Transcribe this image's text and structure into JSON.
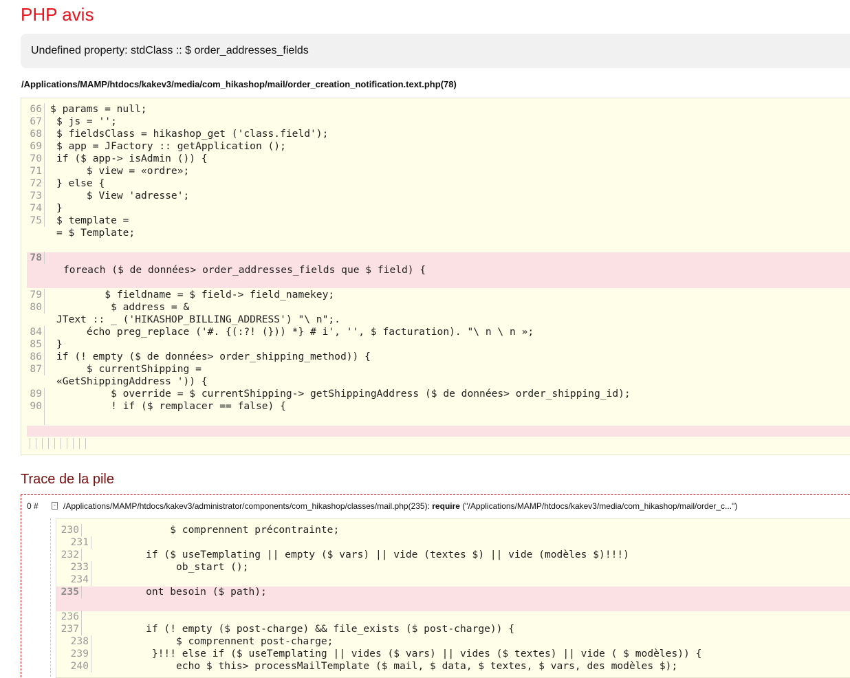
{
  "page_title": "PHP avis",
  "message": "Undefined property: stdClass :: $ order_addresses_fields",
  "file_path": "/Applications/MAMP/htdocs/kakev3/media/com_hikashop/mail/order_creation_notification.text.php(78)",
  "code_lines": [
    {
      "num": "66",
      "text": "$ params = null;"
    },
    {
      "num": "67",
      "text": "$ js = '';"
    },
    {
      "num": "68",
      "text": "$ fieldsClass = hikashop_get ('class.field');"
    },
    {
      "num": "69",
      "text": "$ app = JFactory :: getApplication ();"
    },
    {
      "num": "70",
      "text": "if ($ app-> isAdmin ()) {"
    },
    {
      "num": "71",
      "text": "     $ view = «ordre»;"
    },
    {
      "num": "72",
      "text": "} else {"
    },
    {
      "num": "73",
      "text": "     $ View 'adresse';"
    },
    {
      "num": "74",
      "text": "}"
    },
    {
      "num": "75",
      "text": "$ template ="
    },
    {
      "num": "",
      "text": "= $ Template;"
    },
    {
      "num": "78",
      "text": "foreach ($ de données> order_addresses_fields que $ field) {"
    },
    {
      "num": "79",
      "text": "        $ fieldname = $ field-> field_namekey;"
    },
    {
      "num": "80",
      "text": "         $ address = &"
    },
    {
      "num": "",
      "text": "JText :: _ ('HIKASHOP_BILLING_ADDRESS') \"\\ n\";."
    },
    {
      "num": "84",
      "text": "     écho preg_replace ('#. {(:?! (})) *} # i', '', $ facturation). \"\\ n \\ n »;"
    },
    {
      "num": "85",
      "text": "}"
    },
    {
      "num": "86",
      "text": "if (! empty ($ de données> order_shipping_method)) {"
    },
    {
      "num": "87",
      "text": "     $ currentShipping ="
    },
    {
      "num": "",
      "text": "«GetShippingAddress ')) {"
    },
    {
      "num": "89",
      "text": "         $ override = $ currentShipping-> getShippingAddress ($ de données> order_shipping_id);"
    },
    {
      "num": "90",
      "text": "         ! if ($ remplacer == false) {"
    }
  ],
  "stack_title": "Trace de la pile",
  "frame": {
    "index": "0 #",
    "toggle": "-",
    "location": "/Applications/MAMP/htdocs/kakev3/administrator/components/com_hikashop/classes/mail.php(235):",
    "function": "require",
    "args": "(\"/Applications/MAMP/htdocs/kakev3/media/com_hikashop/mail/order_c...\")"
  },
  "stack_lines": [
    {
      "num": "230",
      "text": "             $ comprennent précontrainte;"
    },
    {
      "num": "231",
      "text": ""
    },
    {
      "num": "232",
      "text": "         if ($ useTemplating || empty ($ vars) || vide (textes $) || vide (modèles $)!!!)"
    },
    {
      "num": "233",
      "text": "              ob_start ();"
    },
    {
      "num": "234",
      "text": ""
    },
    {
      "num": "235",
      "text": "         ont besoin ($ path);"
    },
    {
      "num": "236",
      "text": ""
    },
    {
      "num": "237",
      "text": "         if (! empty ($ post-charge) && file_exists ($ post-charge)) {"
    },
    {
      "num": "238",
      "text": "              $ comprennent post-charge;"
    },
    {
      "num": "239",
      "text": "          }!!! else if ($ useTemplating || vides ($ vars) || vides ($ textes) || vide ( $ modèles)) {"
    },
    {
      "num": "240",
      "text": "              echo $ this> processMailTemplate ($ mail, $ data, $ textes, $ vars, des modèles $);"
    }
  ],
  "colors": {
    "title": "#e5141c",
    "stack_title": "#7a1010",
    "code_background": "#fefee9",
    "highlight": "#fbe1e4",
    "message_background": "#f1f1f1"
  }
}
